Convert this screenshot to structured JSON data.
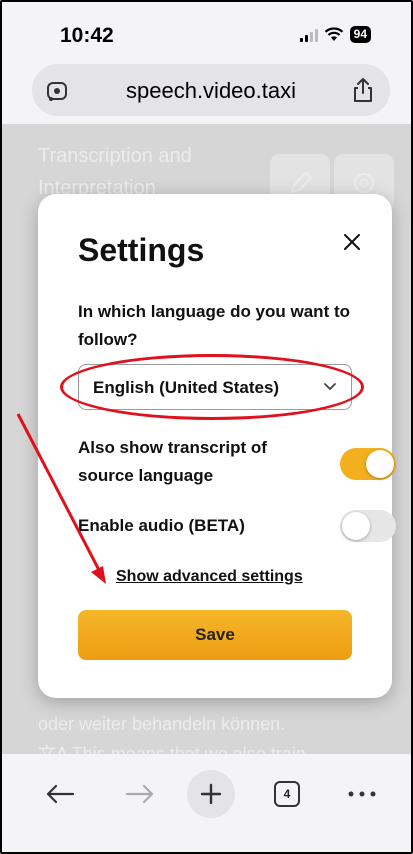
{
  "status_bar": {
    "time": "10:42",
    "battery": "94"
  },
  "address_bar": {
    "url": "speech.video.taxi"
  },
  "background_page": {
    "title": "Transcription and Interpretation",
    "line_1": "oder weiter behandeln können.",
    "line_2": "文A This means that we also train"
  },
  "modal": {
    "title": "Settings",
    "question": "In which language do you want to follow?",
    "language_selected": "English (United States)",
    "toggle_transcript_label": "Also show transcript of source language",
    "toggle_transcript_on": true,
    "toggle_audio_label": "Enable audio (BETA)",
    "toggle_audio_on": false,
    "advanced_link": "Show advanced settings",
    "save_label": "Save"
  },
  "toolbar": {
    "tab_count": "4"
  },
  "colors": {
    "accent": "#f2b01e",
    "annotation_red": "#e0101c",
    "overlay": "#d6d6d6"
  }
}
